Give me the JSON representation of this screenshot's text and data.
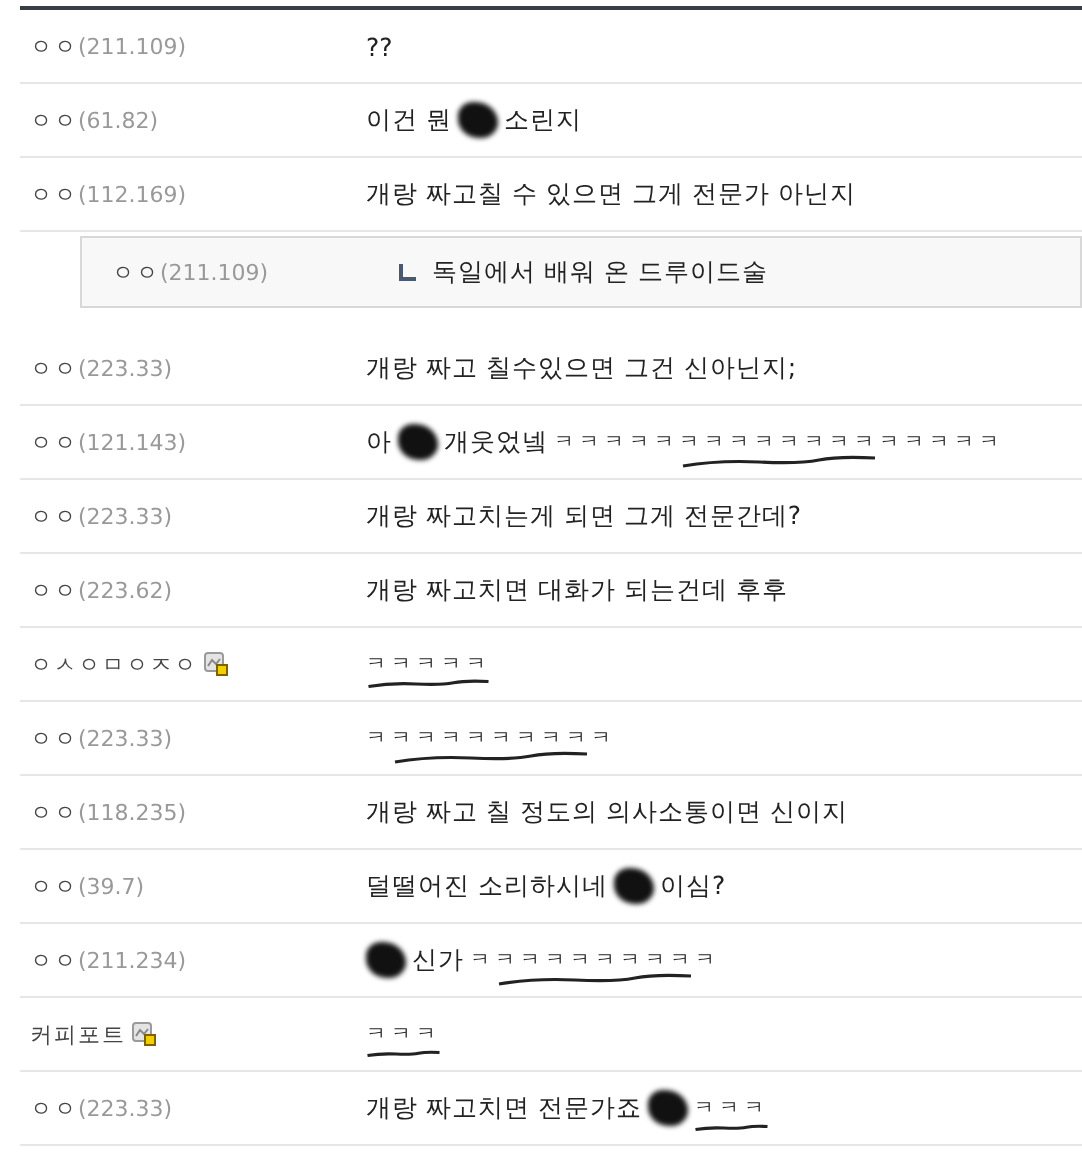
{
  "comments": [
    {
      "author": "ㅇㅇ",
      "ip": "(211.109)",
      "member": false,
      "reply": false,
      "segments": [
        {
          "kind": "text",
          "text": "??"
        }
      ]
    },
    {
      "author": "ㅇㅇ",
      "ip": "(61.82)",
      "member": false,
      "reply": false,
      "segments": [
        {
          "kind": "text",
          "text": "이건 뭔"
        },
        {
          "kind": "scribble"
        },
        {
          "kind": "text",
          "text": "소린지"
        }
      ]
    },
    {
      "author": "ㅇㅇ",
      "ip": "(112.169)",
      "member": false,
      "reply": false,
      "segments": [
        {
          "kind": "text",
          "text": "개랑 짜고칠 수 있으면 그게 전문가 아닌지"
        }
      ]
    },
    {
      "author": "ㅇㅇ",
      "ip": "(211.109)",
      "member": false,
      "reply": true,
      "segments": [
        {
          "kind": "text",
          "text": "독일에서 배워 온 드루이드술"
        }
      ]
    },
    {
      "author": "ㅇㅇ",
      "ip": "(223.33)",
      "member": false,
      "reply": false,
      "segments": [
        {
          "kind": "text",
          "text": "개랑 짜고 칠수있으면 그건 신아닌지;"
        }
      ]
    },
    {
      "author": "ㅇㅇ",
      "ip": "(121.143)",
      "member": false,
      "reply": false,
      "segments": [
        {
          "kind": "text",
          "text": "아"
        },
        {
          "kind": "scribble"
        },
        {
          "kind": "text",
          "text": "개웃었넼"
        },
        {
          "kind": "underlined",
          "text": "ㅋㅋㅋㅋㅋㅋㅋㅋㅋㅋㅋㅋㅋㅋㅋㅋㅋㅋ"
        }
      ]
    },
    {
      "author": "ㅇㅇ",
      "ip": "(223.33)",
      "member": false,
      "reply": false,
      "segments": [
        {
          "kind": "text",
          "text": "개랑 짜고치는게 되면 그게 전문간데?"
        }
      ]
    },
    {
      "author": "ㅇㅇ",
      "ip": "(223.62)",
      "member": false,
      "reply": false,
      "segments": [
        {
          "kind": "text",
          "text": "개랑 짜고치면 대화가 되는건데 후후"
        }
      ]
    },
    {
      "author": "ㅇㅅㅇㅁㅇㅈㅇ",
      "member": true,
      "reply": false,
      "segments": [
        {
          "kind": "underlined",
          "text": "ㅋㅋㅋㅋㅋ"
        }
      ]
    },
    {
      "author": "ㅇㅇ",
      "ip": "(223.33)",
      "member": false,
      "reply": false,
      "segments": [
        {
          "kind": "underlined",
          "text": "ㅋㅋㅋㅋㅋㅋㅋㅋㅋㅋ"
        }
      ]
    },
    {
      "author": "ㅇㅇ",
      "ip": "(118.235)",
      "member": false,
      "reply": false,
      "segments": [
        {
          "kind": "text",
          "text": "개랑 짜고 칠 정도의 의사소통이면 신이지"
        }
      ]
    },
    {
      "author": "ㅇㅇ",
      "ip": "(39.7)",
      "member": false,
      "reply": false,
      "segments": [
        {
          "kind": "text",
          "text": "덜떨어진 소리하시네"
        },
        {
          "kind": "scribble"
        },
        {
          "kind": "text",
          "text": "이심?"
        }
      ]
    },
    {
      "author": "ㅇㅇ",
      "ip": "(211.234)",
      "member": false,
      "reply": false,
      "segments": [
        {
          "kind": "scribble"
        },
        {
          "kind": "text",
          "text": "신가"
        },
        {
          "kind": "underlined",
          "text": "ㅋㅋㅋㅋㅋㅋㅋㅋㅋㅋ"
        }
      ]
    },
    {
      "author": "커피포트",
      "member": true,
      "reply": false,
      "segments": [
        {
          "kind": "underlined",
          "text": "ㅋㅋㅋ"
        }
      ]
    },
    {
      "author": "ㅇㅇ",
      "ip": "(223.33)",
      "member": false,
      "reply": false,
      "segments": [
        {
          "kind": "text",
          "text": "개랑 짜고치면 전문가죠"
        },
        {
          "kind": "scribble"
        },
        {
          "kind": "underlined",
          "text": "ㅋㅋㅋ"
        }
      ]
    }
  ]
}
